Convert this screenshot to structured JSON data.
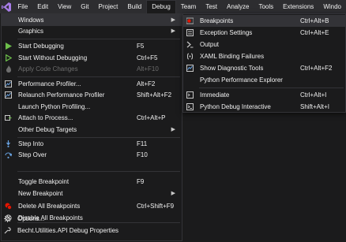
{
  "menubar": {
    "items": [
      {
        "label": "File"
      },
      {
        "label": "Edit"
      },
      {
        "label": "View"
      },
      {
        "label": "Git"
      },
      {
        "label": "Project"
      },
      {
        "label": "Build"
      },
      {
        "label": "Debug"
      },
      {
        "label": "Team"
      },
      {
        "label": "Test"
      },
      {
        "label": "Analyze"
      },
      {
        "label": "Tools"
      },
      {
        "label": "Extensions"
      },
      {
        "label": "Windo"
      }
    ]
  },
  "debug_menu": {
    "items": [
      {
        "label": "Windows",
        "shortcut": ""
      },
      {
        "label": "Graphics",
        "shortcut": ""
      },
      {
        "label": "Start Debugging",
        "shortcut": "F5"
      },
      {
        "label": "Start Without Debugging",
        "shortcut": "Ctrl+F5"
      },
      {
        "label": "Apply Code Changes",
        "shortcut": "Alt+F10"
      },
      {
        "label": "Performance Profiler...",
        "shortcut": "Alt+F2"
      },
      {
        "label": "Relaunch Performance Profiler",
        "shortcut": "Shift+Alt+F2"
      },
      {
        "label": "Launch Python Profiling...",
        "shortcut": ""
      },
      {
        "label": "Attach to Process...",
        "shortcut": "Ctrl+Alt+P"
      },
      {
        "label": "Other Debug Targets",
        "shortcut": ""
      },
      {
        "label": "Step Into",
        "shortcut": "F11"
      },
      {
        "label": "Step Over",
        "shortcut": "F10"
      },
      {
        "label": "Toggle Breakpoint",
        "shortcut": "F9"
      },
      {
        "label": "New Breakpoint",
        "shortcut": ""
      },
      {
        "label": "Delete All Breakpoints",
        "shortcut": "Ctrl+Shift+F9"
      },
      {
        "label": "Disable All Breakpoints",
        "shortcut": ""
      },
      {
        "label": "Options...",
        "shortcut": ""
      },
      {
        "label": "Becht.Utilities.API Debug Properties",
        "shortcut": ""
      }
    ]
  },
  "windows_submenu": {
    "items": [
      {
        "label": "Breakpoints",
        "shortcut": "Ctrl+Alt+B"
      },
      {
        "label": "Exception Settings",
        "shortcut": "Ctrl+Alt+E"
      },
      {
        "label": "Output",
        "shortcut": ""
      },
      {
        "label": "XAML Binding Failures",
        "shortcut": ""
      },
      {
        "label": "Show Diagnostic Tools",
        "shortcut": "Ctrl+Alt+F2"
      },
      {
        "label": "Python Performance Explorer",
        "shortcut": ""
      },
      {
        "label": "Immediate",
        "shortcut": "Ctrl+Alt+I"
      },
      {
        "label": "Python Debug Interactive",
        "shortcut": "Shift+Alt+I"
      }
    ]
  },
  "colors": {
    "menubar_bg": "#2d2d30",
    "menu_bg": "#1b1b1c",
    "highlight": "#333337",
    "vs_purple": "#7a4fc4",
    "play_green": "#6dbf4b",
    "breakpoint_red": "#e51400",
    "step_blue": "#6aa5e6"
  }
}
